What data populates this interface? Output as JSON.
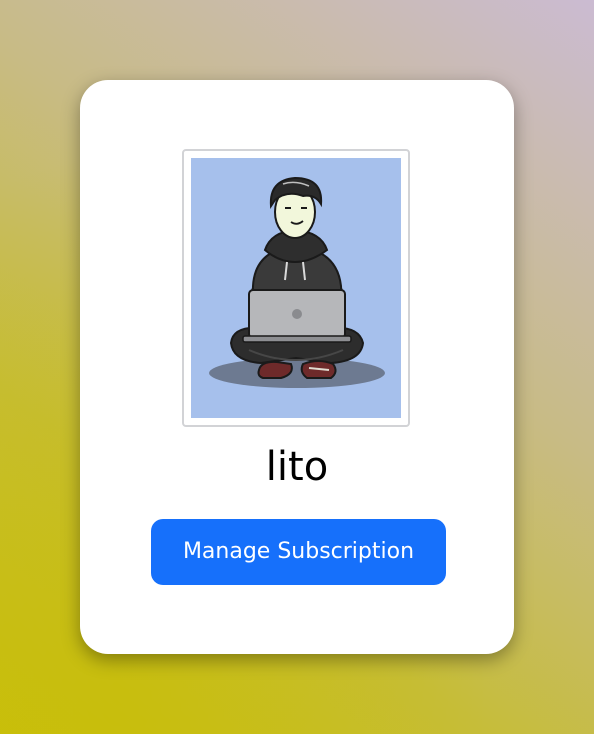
{
  "profile": {
    "username": "lito",
    "avatar_icon": "person-with-laptop-illustration",
    "avatar_background": "#a6c0ec"
  },
  "actions": {
    "manage_subscription_label": "Manage Subscription"
  },
  "colors": {
    "button": "#1670fb",
    "card": "#ffffff"
  }
}
